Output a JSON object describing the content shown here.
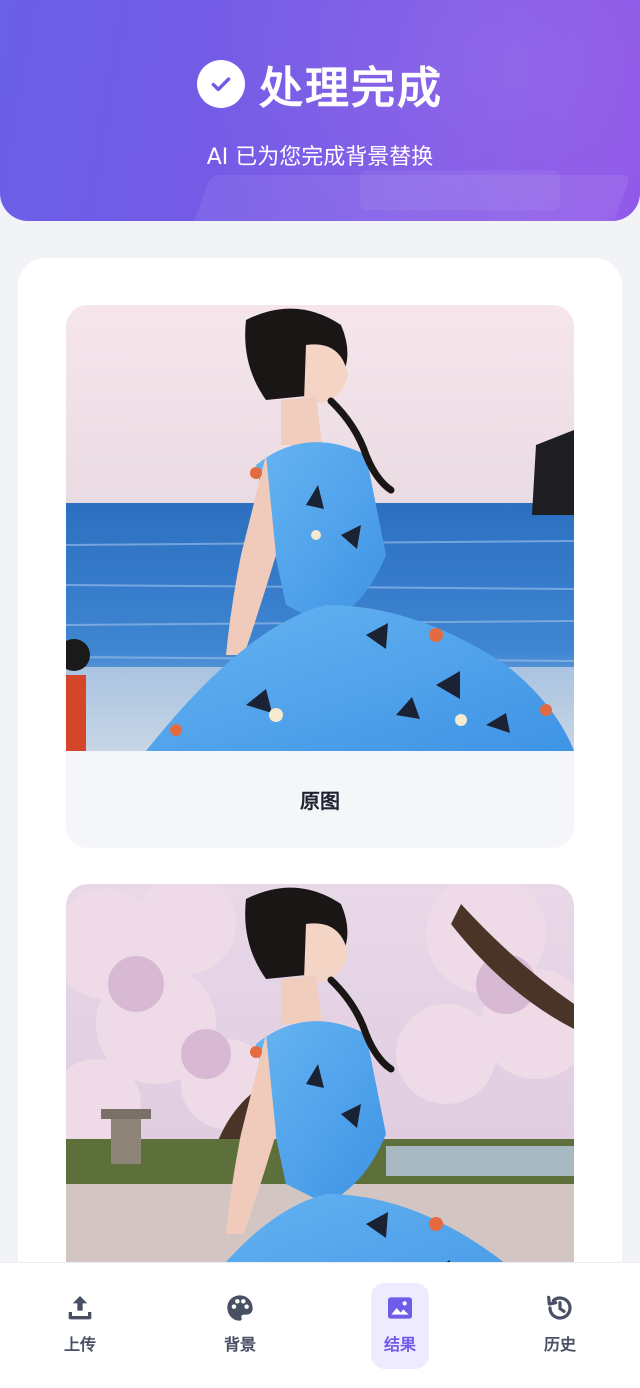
{
  "header": {
    "title": "处理完成",
    "subtitle": "AI 已为您完成背景替换"
  },
  "results": {
    "original_label": "原图"
  },
  "nav": {
    "items": [
      {
        "label": "上传",
        "icon": "upload-icon",
        "active": false
      },
      {
        "label": "背景",
        "icon": "palette-icon",
        "active": false
      },
      {
        "label": "结果",
        "icon": "image-icon",
        "active": true
      },
      {
        "label": "历史",
        "icon": "history-icon",
        "active": false
      }
    ]
  },
  "colors": {
    "accent": "#6f5ce8",
    "header_start": "#6a5fe6",
    "header_end": "#8d52e8"
  }
}
